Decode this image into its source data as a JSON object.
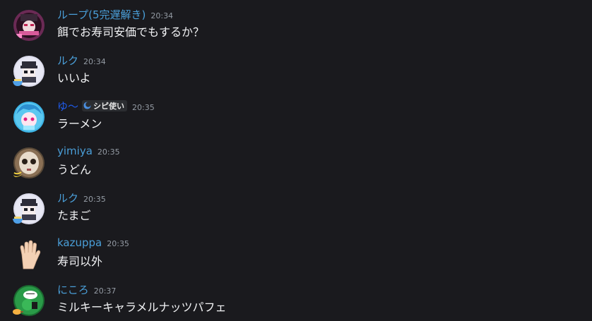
{
  "messages": [
    {
      "username": "ループ(5完遅解き)",
      "timestamp": "20:34",
      "text": "餌でお寿司安価でもするか？",
      "avatar": "anime-girl-pink-avatar",
      "name_color": "#4a9fd9"
    },
    {
      "username": "ルク",
      "timestamp": "20:34",
      "text": "いいよ",
      "avatar": "pixel-character-avatar",
      "name_color": "#4a9fd9"
    },
    {
      "username": "ゆ～",
      "timestamp": "20:35",
      "text": "ラーメン",
      "avatar": "cyan-hair-girl-avatar",
      "name_color": "#1f5ae8",
      "role_tag": "シピ使い"
    },
    {
      "username": "yimiya",
      "timestamp": "20:35",
      "text": "うどん",
      "avatar": "doll-face-avatar",
      "name_color": "#4a9fd9"
    },
    {
      "username": "ルク",
      "timestamp": "20:35",
      "text": "たまご",
      "avatar": "pixel-character-avatar",
      "name_color": "#4a9fd9"
    },
    {
      "username": "kazuppa",
      "timestamp": "20:35",
      "text": "寿司以外",
      "avatar": "raised-hand-avatar",
      "name_color": "#4a9fd9"
    },
    {
      "username": "にころ",
      "timestamp": "20:37",
      "text": "ミルキーキャラメルナッツパフェ",
      "avatar": "green-frog-avatar",
      "name_color": "#4a9fd9"
    }
  ]
}
